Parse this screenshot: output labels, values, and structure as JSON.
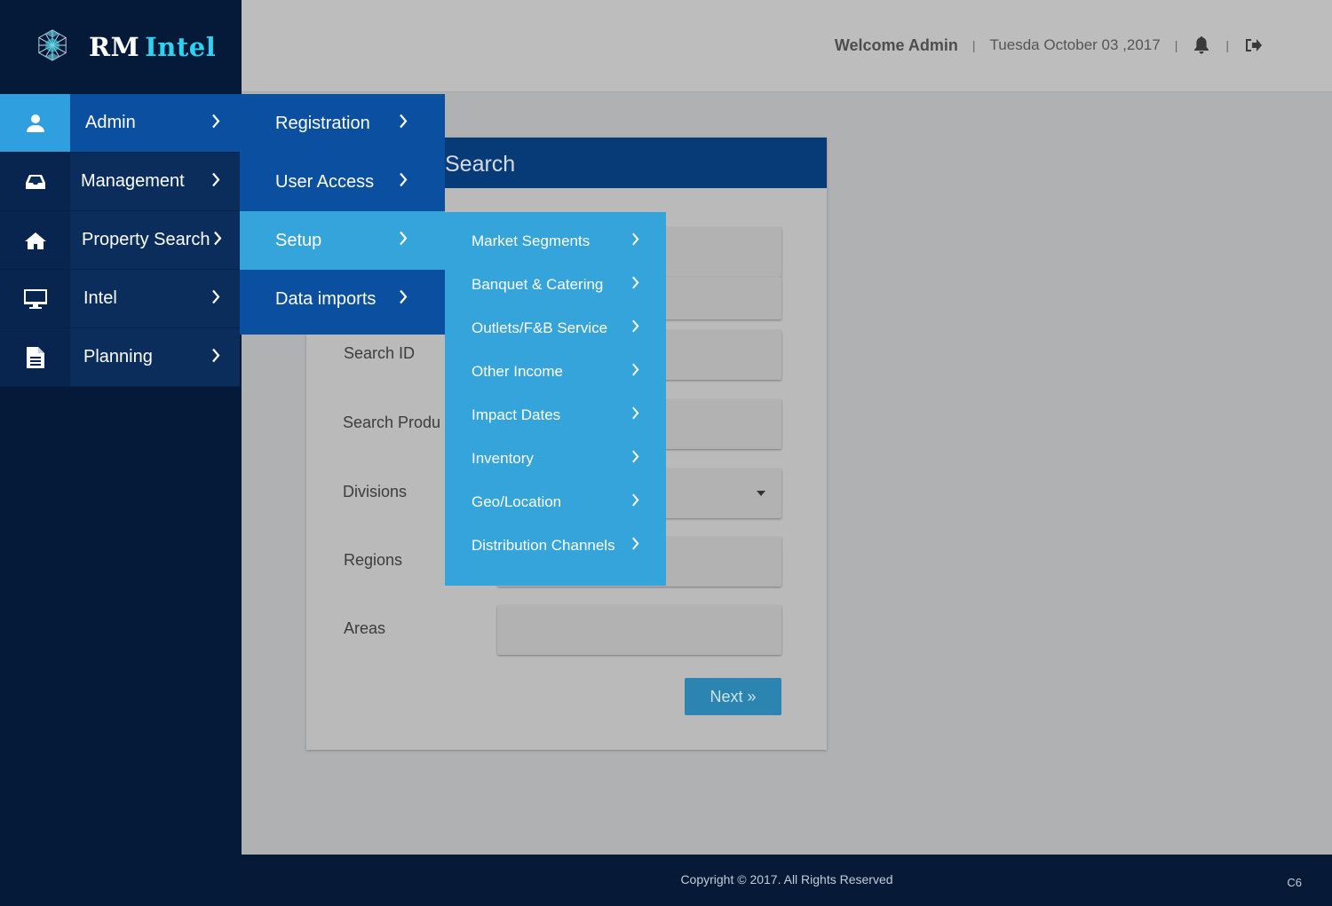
{
  "brand": {
    "name_part1": "RM",
    "name_part2": "Intel",
    "logo_icon": "hexagon-mesh-logo"
  },
  "header": {
    "welcome": "Welcome Admin",
    "date": "Tuesda October 03 ,2017",
    "separator": "|",
    "notification_icon": "bell-icon",
    "logout_icon": "sign-out-icon"
  },
  "sidebar": {
    "items": [
      {
        "label": "Admin",
        "icon": "user-icon",
        "active": true
      },
      {
        "label": "Management",
        "icon": "inbox-icon",
        "active": false
      },
      {
        "label": "Property Search",
        "icon": "home-icon",
        "active": false
      },
      {
        "label": "Intel",
        "icon": "desktop-icon",
        "active": false
      },
      {
        "label": "Planning",
        "icon": "document-icon",
        "active": false
      }
    ]
  },
  "submenu_admin": {
    "items": [
      {
        "label": "Registration",
        "active": false
      },
      {
        "label": "User Access",
        "active": false
      },
      {
        "label": "Setup",
        "active": true
      },
      {
        "label": "Data imports",
        "active": false
      }
    ]
  },
  "submenu_setup": {
    "items": [
      {
        "label": "Market Segments"
      },
      {
        "label": "Banquet & Catering"
      },
      {
        "label": "Outlets/F&B Service"
      },
      {
        "label": "Other Income"
      },
      {
        "label": "Impact Dates"
      },
      {
        "label": "Inventory"
      },
      {
        "label": "Geo/Location"
      },
      {
        "label": "Distribution Channels"
      }
    ]
  },
  "card": {
    "title": "Search",
    "fields": [
      {
        "label": "Search ID"
      },
      {
        "label": "Search Produ"
      },
      {
        "label": "Divisions"
      },
      {
        "label": "Regions"
      },
      {
        "label": "Areas"
      }
    ],
    "next_label": "Next »"
  },
  "footer": {
    "copyright": "Copyright © 2017. All Rights Reserved",
    "code": "C6"
  },
  "colors": {
    "sidebar_bg": "#051938",
    "active_blue": "#0a4fa0",
    "light_blue": "#35a4da",
    "brand_accent": "#2fd3f2",
    "next_button": "#2c84b0"
  }
}
